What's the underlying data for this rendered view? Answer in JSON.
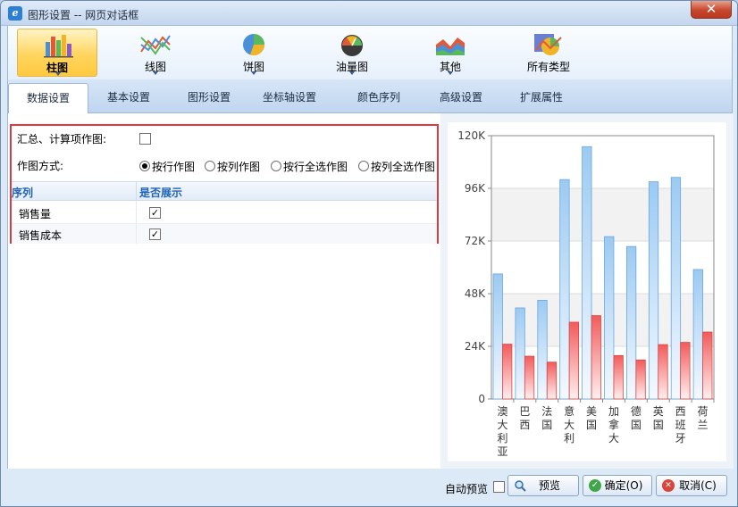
{
  "window": {
    "title": "图形设置 -- 网页对话框",
    "close_glyph": "✕"
  },
  "chart_types": [
    {
      "label": "柱图",
      "icon": "bar-chart-icon",
      "active": true
    },
    {
      "label": "线图",
      "icon": "line-chart-icon",
      "active": false
    },
    {
      "label": "饼图",
      "icon": "pie-chart-icon",
      "active": false
    },
    {
      "label": "油量图",
      "icon": "gauge-chart-icon",
      "active": false
    },
    {
      "label": "其他",
      "icon": "area-chart-icon",
      "active": false
    },
    {
      "label": "所有类型",
      "icon": "all-types-icon",
      "active": false
    }
  ],
  "tabs": [
    "数据设置",
    "基本设置",
    "图形设置",
    "坐标轴设置",
    "颜色序列",
    "高级设置",
    "扩展属性"
  ],
  "active_tab": 0,
  "data_settings": {
    "summary_label": "汇总、计算项作图:",
    "summary_checked": false,
    "mode_label": "作图方式:",
    "modes": [
      {
        "label": "按行作图",
        "selected": true
      },
      {
        "label": "按列作图",
        "selected": false
      },
      {
        "label": "按行全选作图",
        "selected": false
      },
      {
        "label": "按列全选作图",
        "selected": false
      }
    ],
    "grid_headers": {
      "series": "序列",
      "show": "是否展示"
    },
    "rows": [
      {
        "name": "销售量",
        "show": true
      },
      {
        "name": "销售成本",
        "show": true
      }
    ]
  },
  "footer": {
    "auto_preview_label": "自动预览",
    "auto_preview_checked": false,
    "preview_label": "预览",
    "ok_label": "确定(O)",
    "cancel_label": "取消(C)"
  },
  "colors": {
    "series_1": "#9ccaf2",
    "series_2": "#f25b5b",
    "accent": "#e0383d",
    "header_text": "#1f63b5"
  },
  "chart_data": {
    "type": "bar",
    "categories": [
      "澳大利亚",
      "巴西",
      "法国",
      "意大利",
      "美国",
      "加拿大",
      "德国",
      "英国",
      "西班牙",
      "荷兰"
    ],
    "series": [
      {
        "name": "销售量",
        "values": [
          57000,
          41500,
          45000,
          100000,
          115000,
          74000,
          69500,
          99000,
          101000,
          59000
        ]
      },
      {
        "name": "销售成本",
        "values": [
          25000,
          19500,
          16800,
          35000,
          38000,
          19800,
          17800,
          24800,
          25800,
          30500
        ]
      }
    ],
    "yticks": [
      "0",
      "24K",
      "48K",
      "72K",
      "96K",
      "120K"
    ],
    "ylim": [
      0,
      120000
    ],
    "grid": true,
    "legend": false
  }
}
